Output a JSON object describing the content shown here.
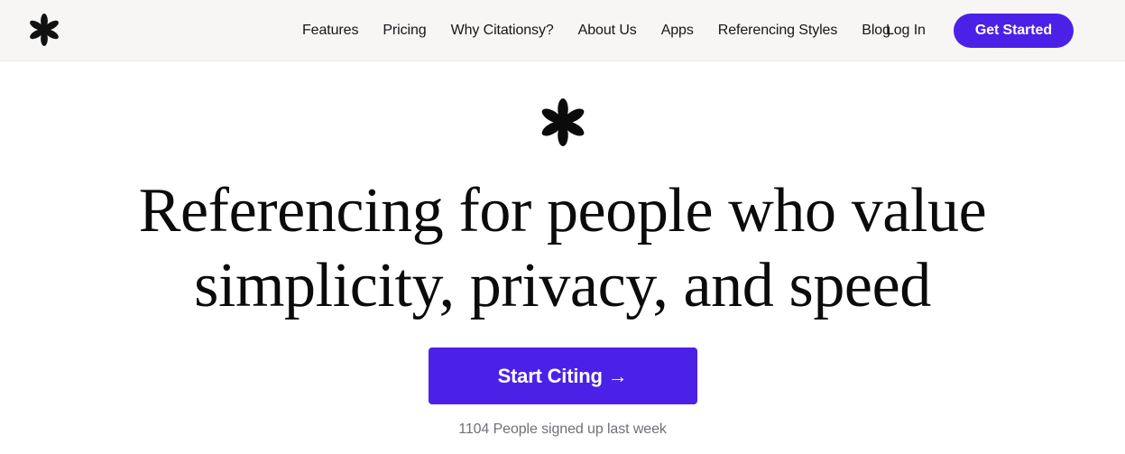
{
  "brand": {
    "name": "Citationsy",
    "logo_icon": "asterisk-icon",
    "accent_color": "#4b21e8",
    "header_background": "#f7f6f4",
    "page_background": "#ffffff",
    "text_color": "#16161a",
    "muted_text_color": "#6e7277"
  },
  "header": {
    "nav_items": [
      {
        "label": "Features"
      },
      {
        "label": "Pricing"
      },
      {
        "label": "Why Citationsy?"
      },
      {
        "label": "About Us"
      },
      {
        "label": "Apps"
      },
      {
        "label": "Referencing Styles"
      },
      {
        "label": "Blog"
      }
    ],
    "login_label": "Log In",
    "get_started_label": "Get Started"
  },
  "hero": {
    "logo_icon": "asterisk-icon",
    "headline_line_1": "Referencing for people who value",
    "headline_line_2": "simplicity, privacy, and speed",
    "cta_label": "Start Citing →",
    "signup_note": "1104 People signed up last week"
  }
}
